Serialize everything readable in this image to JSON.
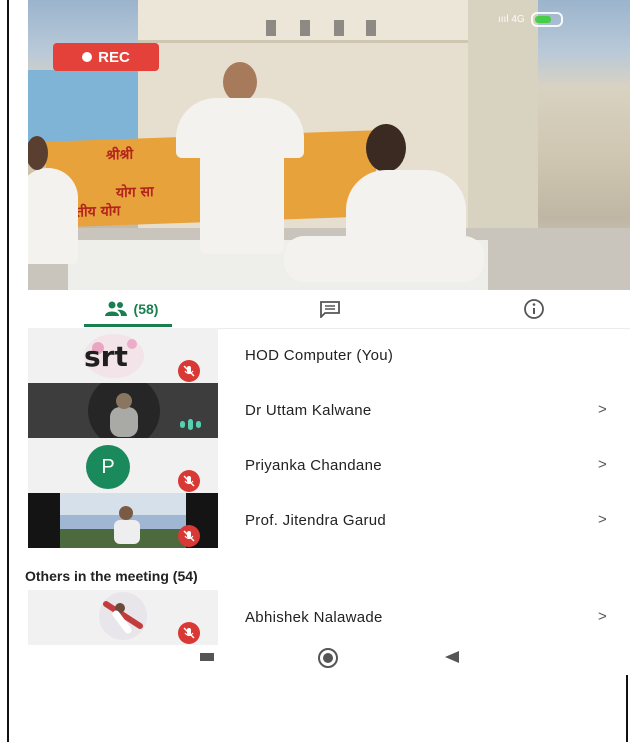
{
  "status_bar": {
    "network": "4G",
    "signal_text": "ıııl 4G"
  },
  "recording": {
    "label": "REC"
  },
  "tabs": {
    "people_count": "(58)",
    "chat_icon": "chat-icon",
    "info_icon": "info-icon",
    "accent": "#1a7f4f"
  },
  "participants": [
    {
      "name": "HOD Computer (You)",
      "thumb": "srt-logo",
      "logo_text": "srt",
      "muted": true,
      "chevron": ""
    },
    {
      "name": "Dr Uttam Kalwane",
      "thumb": "video",
      "speaking": true,
      "chevron": ">"
    },
    {
      "name": "Priyanka Chandane",
      "thumb": "initial",
      "initial": "P",
      "muted": true,
      "chevron": ">"
    },
    {
      "name": "Prof. Jitendra Garud",
      "thumb": "video",
      "muted": true,
      "chevron": ">"
    }
  ],
  "others": {
    "label": "Others in the meeting (54)",
    "items": [
      {
        "name": "Abhishek Nalawade",
        "thumb": "photo",
        "muted": true,
        "chevron": ">"
      }
    ]
  },
  "colors": {
    "mute_red": "#d93934",
    "rec_red": "#e5413b",
    "avatar_green": "#1a8a5c"
  }
}
